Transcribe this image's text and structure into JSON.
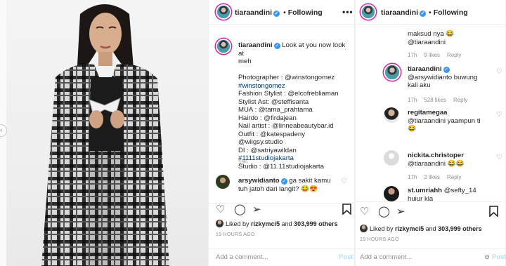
{
  "photo": {
    "alt": "tiaraandini photo",
    "nav_prev": "‹"
  },
  "panel1": {
    "header": {
      "username": "tiaraandini",
      "verified": "✓",
      "dot": "•",
      "following": "Following",
      "more": "•••"
    },
    "caption": {
      "username": "tiaraandini",
      "verified": "✓",
      "lines": [
        "Look at you now look at",
        "meh",
        "",
        "Photographer : @winstongomez",
        "#winstongomez",
        "Fashion Stylist : @elcofrebliaman",
        "Stylist Ast: @steffisanta",
        "MUA : @tama_prahtama",
        "Hairdo : @firdajean",
        "Nail artist : @linneabeautybar.id",
        "Outfit : @katespadeny @wiigsy.studio",
        "DI : @satriyawildan",
        "#1111studiojakarta",
        "Studio : @11.11studiojakarta"
      ],
      "time": "19h"
    },
    "comment": {
      "username": "arsywidianto",
      "verified": "✓",
      "text1": "ga sakit kamu",
      "text2": "tuh jatoh dari langit? 😂😍"
    },
    "likes": {
      "by": "Liked by",
      "user": "rizkymci5",
      "and": "and",
      "count": "303,999 others"
    },
    "ago": "19 HOURS AGO",
    "add_comment": {
      "placeholder": "Add a comment...",
      "post": "Post"
    }
  },
  "panel2": {
    "header": {
      "username": "tiaraandini",
      "verified": "✓",
      "dot": "•",
      "following": "Following"
    },
    "comments": [
      {
        "username": "",
        "text": [
          "maksud nya 😂",
          "@tiaraandini"
        ],
        "time": "17h",
        "likes": "9 likes",
        "reply": "Reply"
      },
      {
        "username": "tiaraandini",
        "verified": "✓",
        "text": [
          "@arsywidianto buwung",
          "kali aku"
        ],
        "time": "17h",
        "likes": "528 likes",
        "reply": "Reply"
      },
      {
        "username": "regitamegaa",
        "text": [
          "@tiaraandini yaampun ti",
          "😂"
        ],
        "time": "17h",
        "likes": "9 likes",
        "reply": "Reply"
      },
      {
        "username": "nickita.christoper",
        "text": [
          "@tiaraandini 😂😂"
        ],
        "time": "17h",
        "likes": "2 likes",
        "reply": "Reply"
      },
      {
        "username": "st.umriahh",
        "text": [
          "@sefty_14",
          "hujur kla"
        ]
      }
    ],
    "likes": {
      "by": "Liked by",
      "user": "rizkymci5",
      "and": "and",
      "count": "303,999 others"
    },
    "ago": "19 HOURS AGO",
    "add_comment": {
      "placeholder": "Add a comment...",
      "post": "Post"
    }
  },
  "colors": {
    "verified": "#3897f0",
    "link": "#00376b",
    "muted": "#8e8e8e",
    "post": "#b2dffc"
  },
  "icons": [
    "heart-icon",
    "comment-icon",
    "share-icon",
    "bookmark-icon",
    "more-icon",
    "chevron-left-icon",
    "emoji-icon"
  ]
}
